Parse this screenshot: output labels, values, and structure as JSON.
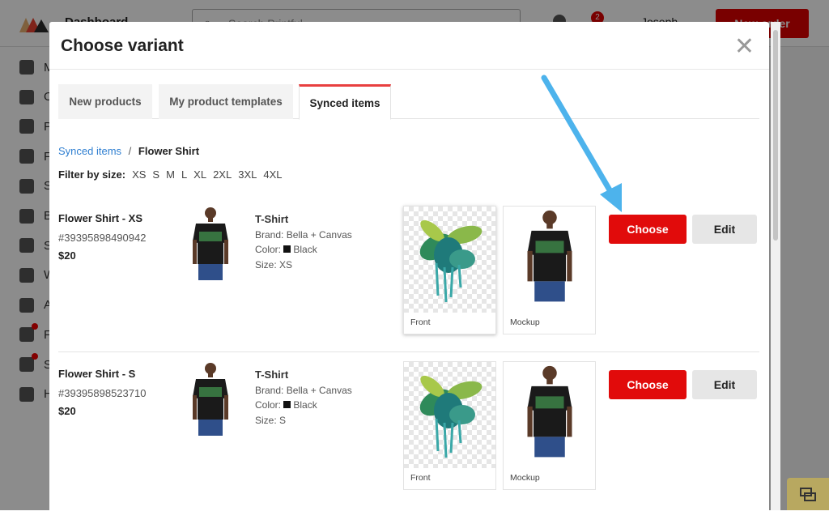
{
  "background": {
    "nav_title": "Dashboard",
    "search_placeholder": "Search Printful",
    "notification_count": "2",
    "user_name": "Joseph",
    "new_order_label": "New order",
    "sidebar_letters": [
      "M",
      "O",
      "P",
      "F",
      "S",
      "B",
      "S",
      "W",
      "A",
      "F",
      "S",
      "H"
    ],
    "sidebar_icons": [
      "pie-chart-icon",
      "list-icon",
      "product-icon",
      "gallery-icon",
      "store-icon",
      "billing-icon",
      "stats-icon",
      "warehouse-icon",
      "users-icon",
      "toolbox-icon",
      "settings-icon",
      "help-icon"
    ]
  },
  "modal": {
    "title": "Choose variant",
    "tabs": [
      {
        "label": "New products",
        "active": false
      },
      {
        "label": "My product templates",
        "active": false
      },
      {
        "label": "Synced items",
        "active": true
      }
    ],
    "breadcrumb": {
      "parent": "Synced items",
      "separator": "/",
      "current": "Flower Shirt"
    },
    "filter": {
      "label": "Filter by size:",
      "sizes": [
        "XS",
        "S",
        "M",
        "L",
        "XL",
        "2XL",
        "3XL",
        "4XL"
      ]
    },
    "items": [
      {
        "name": "Flower Shirt - XS",
        "sku": "#39395898490942",
        "price": "$20",
        "type": "T-Shirt",
        "brand": "Brand: Bella + Canvas",
        "color_label": "Color:",
        "color": "Black",
        "size": "Size: XS",
        "front_label": "Front",
        "mockup_label": "Mockup",
        "choose_label": "Choose",
        "edit_label": "Edit"
      },
      {
        "name": "Flower Shirt - S",
        "sku": "#39395898523710",
        "price": "$20",
        "type": "T-Shirt",
        "brand": "Brand: Bella + Canvas",
        "color_label": "Color:",
        "color": "Black",
        "size": "Size: S",
        "front_label": "Front",
        "mockup_label": "Mockup",
        "choose_label": "Choose",
        "edit_label": "Edit"
      }
    ]
  },
  "colors": {
    "accent": "#e10b0b",
    "tab_active": "#e84040",
    "link": "#2f7fd1",
    "arrow": "#4db3ec"
  }
}
